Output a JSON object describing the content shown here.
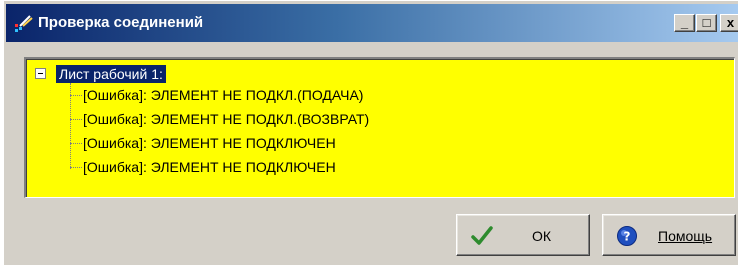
{
  "window": {
    "title": "Проверка соединений",
    "min_symbol": "_",
    "max_symbol": "□",
    "close_symbol": "x"
  },
  "tree": {
    "root": "Лист рабочий 1:",
    "children": [
      "[Ошибка]:  ЭЛЕМЕНТ НЕ ПОДКЛ.(ПОДАЧА)",
      "[Ошибка]:  ЭЛЕМЕНТ НЕ ПОДКЛ.(ВОЗВРАТ)",
      "[Ошибка]:  ЭЛЕМЕНТ НЕ ПОДКЛЮЧЕН",
      "[Ошибка]:  ЭЛЕМЕНТ НЕ ПОДКЛЮЧЕН"
    ],
    "background": "#ffff00",
    "selection_color": "#0a246a"
  },
  "buttons": {
    "ok_label": "ОК",
    "help_label": "Помощь"
  },
  "colors": {
    "titlebar_start": "#0a246a",
    "titlebar_end": "#a6caf0",
    "ok_check": "#2e8b2e",
    "help_icon": "#1f4fbf"
  }
}
